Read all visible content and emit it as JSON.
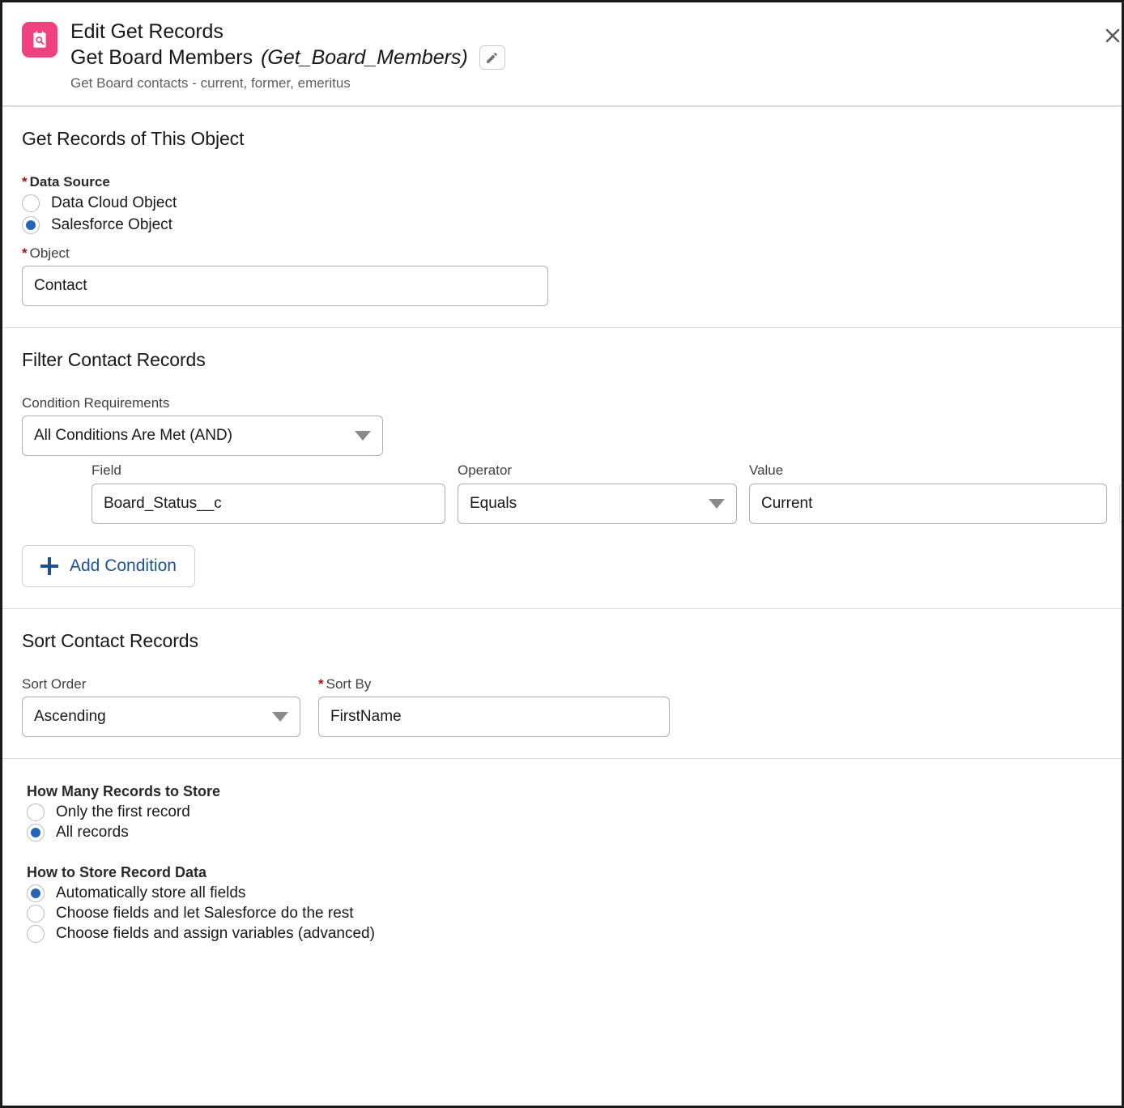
{
  "header": {
    "icon_name": "get-records-clipboard-search-icon",
    "accent_color": "#f0407f",
    "title": "Edit Get Records",
    "element_label": "Get Board Members",
    "element_api_name": "(Get_Board_Members)",
    "description": "Get Board contacts - current, former, emeritus",
    "edit_button_icon": "pencil-icon",
    "close_button_icon": "close-x-icon"
  },
  "object_section": {
    "title": "Get Records of This Object",
    "data_source_label": "Data Source",
    "data_source_options": [
      {
        "label": "Data Cloud Object",
        "selected": false
      },
      {
        "label": "Salesforce Object",
        "selected": true
      }
    ],
    "object_label": "Object",
    "object_value": "Contact"
  },
  "filter_section": {
    "title": "Filter Contact Records",
    "condition_requirements_label": "Condition Requirements",
    "condition_requirements_value": "All Conditions Are Met (AND)",
    "columns": {
      "field": "Field",
      "operator": "Operator",
      "value": "Value"
    },
    "conditions": [
      {
        "field": "Board_Status__c",
        "operator": "Equals",
        "value": "Current",
        "delete_icon": "trash-icon"
      }
    ],
    "add_condition_label": "Add Condition"
  },
  "sort_section": {
    "title": "Sort Contact Records",
    "sort_order_label": "Sort Order",
    "sort_order_value": "Ascending",
    "sort_by_label": "Sort By",
    "sort_by_value": "FirstName"
  },
  "store_section": {
    "how_many_heading": "How Many Records to Store",
    "how_many_options": [
      {
        "label": "Only the first record",
        "selected": false
      },
      {
        "label": "All records",
        "selected": true
      }
    ],
    "how_to_store_heading": "How to Store Record Data",
    "how_to_store_options": [
      {
        "label": "Automatically store all fields",
        "selected": true
      },
      {
        "label": "Choose fields and let Salesforce do the rest",
        "selected": false
      },
      {
        "label": "Choose fields and assign variables (advanced)",
        "selected": false
      }
    ]
  },
  "colors": {
    "accent_pink": "#f0407f",
    "radio_blue": "#2566b8",
    "link_blue": "#1b5297",
    "required_red": "#a01414"
  }
}
